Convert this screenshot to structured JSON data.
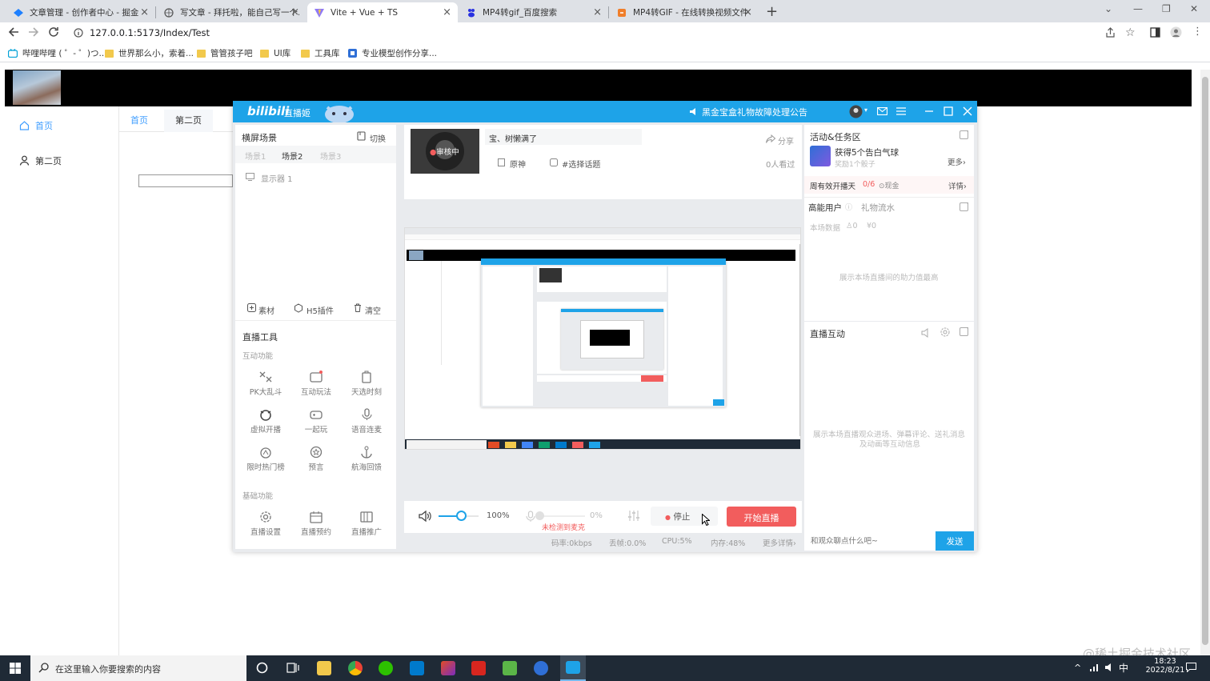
{
  "browser": {
    "tabs": [
      {
        "label": "文章管理 - 创作者中心 - 掘金",
        "icon": "juejin-icon"
      },
      {
        "label": "写文章 - 拜托啦，能自己写一个...",
        "icon": "globe-icon"
      },
      {
        "label": "Vite + Vue + TS",
        "icon": "vite-icon"
      },
      {
        "label": "MP4转gif_百度搜索",
        "icon": "baidu-icon"
      },
      {
        "label": "MP4转GIF - 在线转换视频文件",
        "icon": "convert-icon"
      }
    ],
    "address": "127.0.0.1:5173/Index/Test",
    "bookmarks": [
      "哔哩哔哩 ( ゜- ゜)つ...",
      "世界那么小，索着...",
      "管管孩子吧",
      "UI库",
      "工具库",
      "专业模型创作分享..."
    ]
  },
  "page": {
    "nav": [
      "首页",
      "第二页"
    ],
    "tabs": [
      "首页",
      "第二页"
    ]
  },
  "app": {
    "logo": "bilibili",
    "logo_sub": "直播姬",
    "announcement": "黑金宝盒礼物故障处理公告",
    "left": {
      "scene_title": "横屏场景",
      "switch_label": "切换",
      "scenes": [
        "场景1",
        "场景2",
        "场景3"
      ],
      "source": "显示器 1",
      "actions": [
        "素材",
        "H5插件",
        "清空"
      ],
      "tools_title": "直播工具",
      "interactive_title": "互动功能",
      "interactive_tools": [
        "PK大乱斗",
        "互动玩法",
        "天选时刻",
        "虚拟开播",
        "一起玩",
        "语音连麦",
        "限时热门榜",
        "预言",
        "航海回馈"
      ],
      "basic_title": "基础功能",
      "basic_tools": [
        "直播设置",
        "直播预约",
        "直播推广"
      ]
    },
    "center": {
      "review_badge": "审核中",
      "room_title": "宝、树懒满了",
      "share": "分享",
      "category": "原神",
      "topic": "#选择话题",
      "viewers": "0人看过"
    },
    "controls": {
      "volume": "100%",
      "volume_level": 1.0,
      "mic_level": "0%",
      "mic_warning": "未检测到麦克",
      "stop": "停止",
      "start": "开始直播"
    },
    "status": {
      "bitrate": "码率:0kbps",
      "dropped": "丢帧:0.0%",
      "cpu": "CPU:5%",
      "memory": "内存:48%",
      "more": "更多详情"
    },
    "right": {
      "activity_title": "活动&任务区",
      "task": "获得5个告白气球",
      "task_reward": "奖励1个骰子",
      "more": "更多",
      "weekly": "周有效开播天",
      "weekly_progress": "0/6",
      "cash": "现金",
      "detail": "详情",
      "vip_title": "高能用户",
      "gift_flow": "礼物流水",
      "stats_label": "本场数据",
      "stats_a": "0",
      "stats_b": "¥0",
      "vip_empty": "展示本场直播间的助力值最高",
      "interact_title": "直播互动",
      "interact_empty_1": "展示本场直播观众进场、弹幕评论、送礼消息",
      "interact_empty_2": "及动画等互动信息",
      "input_placeholder": "和观众聊点什么吧~",
      "send": "发送"
    }
  },
  "taskbar": {
    "search": "在这里输入你要搜索的内容",
    "ime": "中",
    "time": "18:23",
    "date": "2022/8/21"
  },
  "watermark": "@稀土掘金技术社区",
  "colors": {
    "bili_blue": "#1ea3e8",
    "start_red": "#f25d5d",
    "send_blue": "#1ea3e8",
    "page_accent": "#409eff"
  }
}
